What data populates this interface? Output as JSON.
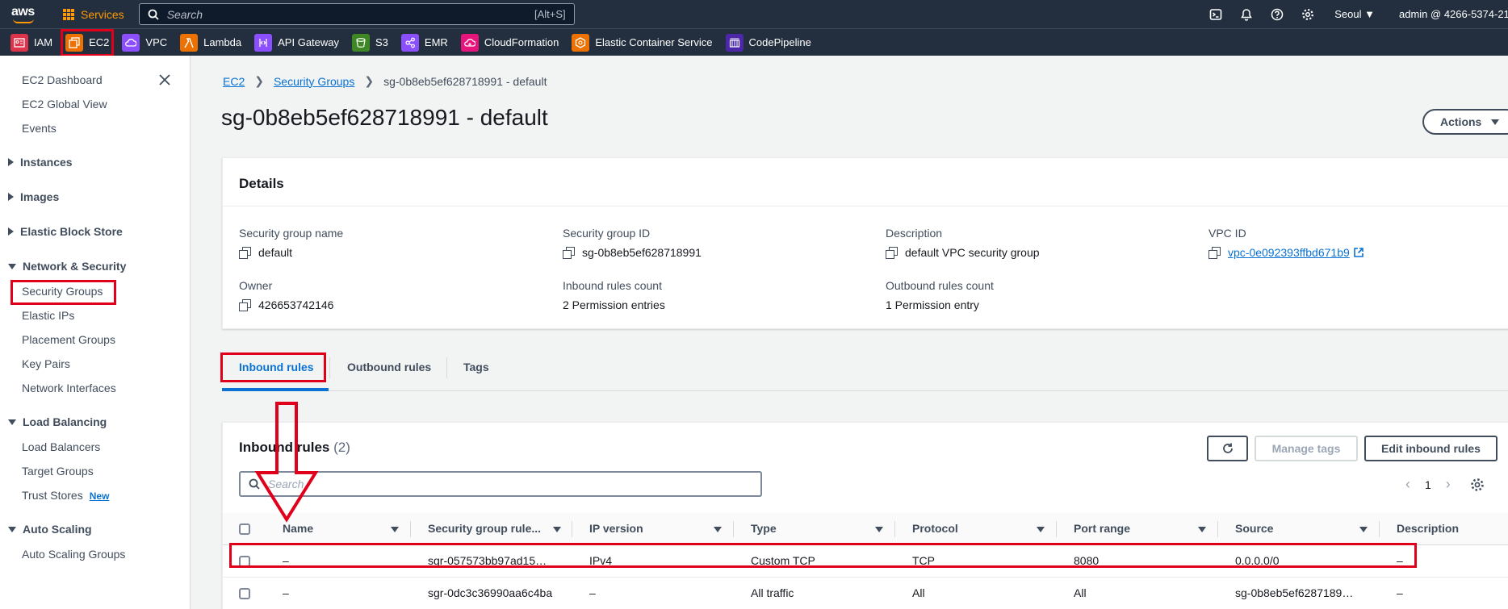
{
  "topnav": {
    "logo_text": "aws",
    "services_label": "Services",
    "search_placeholder": "Search",
    "search_shortcut": "[Alt+S]",
    "region": "Seoul",
    "account": "admin @ 4266-5374-21"
  },
  "favorites": [
    {
      "label": "IAM",
      "color": "#dd344c"
    },
    {
      "label": "EC2",
      "color": "#ed7100"
    },
    {
      "label": "VPC",
      "color": "#8c4fff"
    },
    {
      "label": "Lambda",
      "color": "#ed7100"
    },
    {
      "label": "API Gateway",
      "color": "#8c4fff"
    },
    {
      "label": "S3",
      "color": "#3f8624"
    },
    {
      "label": "EMR",
      "color": "#8c4fff"
    },
    {
      "label": "CloudFormation",
      "color": "#e7157b"
    },
    {
      "label": "Elastic Container Service",
      "color": "#ed7100"
    },
    {
      "label": "CodePipeline",
      "color": "#4d27aa"
    }
  ],
  "sidebar": {
    "top_items": [
      "EC2 Dashboard",
      "EC2 Global View",
      "Events"
    ],
    "sections": [
      {
        "label": "Instances",
        "expanded": false
      },
      {
        "label": "Images",
        "expanded": false
      },
      {
        "label": "Elastic Block Store",
        "expanded": false
      },
      {
        "label": "Network & Security",
        "expanded": true
      },
      {
        "label": "Load Balancing",
        "expanded": true
      },
      {
        "label": "Auto Scaling",
        "expanded": true
      }
    ],
    "network_items": [
      "Security Groups",
      "Elastic IPs",
      "Placement Groups",
      "Key Pairs",
      "Network Interfaces"
    ],
    "lb_items": [
      "Load Balancers",
      "Target Groups",
      "Trust Stores"
    ],
    "new_badge": "New",
    "as_items": [
      "Auto Scaling Groups"
    ]
  },
  "breadcrumb": {
    "root": "EC2",
    "parent": "Security Groups",
    "current": "sg-0b8eb5ef628718991 - default"
  },
  "page_title": "sg-0b8eb5ef628718991 - default",
  "actions_label": "Actions",
  "details": {
    "heading": "Details",
    "sg_name_label": "Security group name",
    "sg_name": "default",
    "sg_id_label": "Security group ID",
    "sg_id": "sg-0b8eb5ef628718991",
    "desc_label": "Description",
    "desc": "default VPC security group",
    "vpc_label": "VPC ID",
    "vpc": "vpc-0e092393ffbd671b9",
    "owner_label": "Owner",
    "owner": "426653742146",
    "in_count_label": "Inbound rules count",
    "in_count": "2 Permission entries",
    "out_count_label": "Outbound rules count",
    "out_count": "1 Permission entry"
  },
  "tabs": [
    "Inbound rules",
    "Outbound rules",
    "Tags"
  ],
  "rules": {
    "title": "Inbound rules",
    "count": "(2)",
    "manage_tags": "Manage tags",
    "edit": "Edit inbound rules",
    "search_placeholder": "Search",
    "page": "1",
    "columns": [
      "Name",
      "Security group rule...",
      "IP version",
      "Type",
      "Protocol",
      "Port range",
      "Source",
      "Description"
    ],
    "rows": [
      [
        "–",
        "sgr-057573bb97ad15…",
        "IPv4",
        "Custom TCP",
        "TCP",
        "8080",
        "0.0.0.0/0",
        "–"
      ],
      [
        "–",
        "sgr-0dc3c36990aa6c4ba",
        "–",
        "All traffic",
        "All",
        "All",
        "sg-0b8eb5ef6287189…",
        "–"
      ]
    ]
  }
}
